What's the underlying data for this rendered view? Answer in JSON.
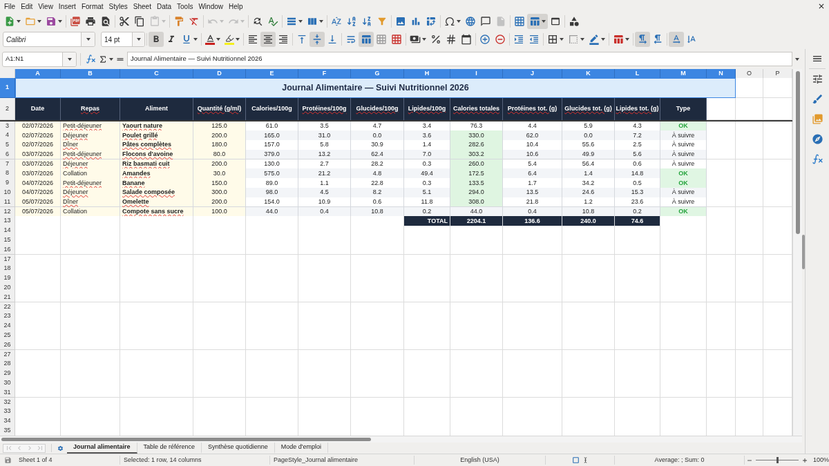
{
  "menu_bar": {
    "items": [
      "File",
      "Edit",
      "View",
      "Insert",
      "Format",
      "Styles",
      "Sheet",
      "Data",
      "Tools",
      "Window",
      "Help"
    ]
  },
  "standard_toolbar": {
    "paste_enabled": false,
    "undo_enabled": false,
    "redo_enabled": false,
    "headers_footers_enabled": false,
    "freeze_rows_columns": true
  },
  "formatting_toolbar": {
    "font_name": "Calibri",
    "font_size": "14 pt",
    "bold": true,
    "italic": false,
    "underline": false,
    "horizontal_align": {
      "left": false,
      "center": true,
      "right": false
    },
    "vertical_align": {
      "top": false,
      "middle": true,
      "bottom": false
    },
    "merge_and_center": true,
    "paragraph_direction": {
      "left_to_right": true,
      "right_to_left": false
    },
    "text_orientation": {
      "horizontal": true,
      "vertical": false
    }
  },
  "formula_bar": {
    "name_box": "A1:N1",
    "content": "Journal Alimentaire — Suivi Nutritionnel 2026"
  },
  "sheet": {
    "columns": [
      {
        "label": "A",
        "selected": true
      },
      {
        "label": "B",
        "selected": true
      },
      {
        "label": "C",
        "selected": true
      },
      {
        "label": "D",
        "selected": true
      },
      {
        "label": "E",
        "selected": true
      },
      {
        "label": "F",
        "selected": true
      },
      {
        "label": "G",
        "selected": true
      },
      {
        "label": "H",
        "selected": true
      },
      {
        "label": "I",
        "selected": true
      },
      {
        "label": "J",
        "selected": true
      },
      {
        "label": "K",
        "selected": true
      },
      {
        "label": "L",
        "selected": true
      },
      {
        "label": "M",
        "selected": true
      },
      {
        "label": "N",
        "selected": true
      },
      {
        "label": "O",
        "selected": false
      },
      {
        "label": "P",
        "selected": false
      }
    ],
    "rows": [
      {
        "label": "1",
        "selected": true
      },
      {
        "label": "2",
        "selected": false
      },
      {
        "label": "3",
        "selected": false
      },
      {
        "label": "4",
        "selected": false
      },
      {
        "label": "5",
        "selected": false
      },
      {
        "label": "6",
        "selected": false
      },
      {
        "label": "7",
        "selected": false
      },
      {
        "label": "8",
        "selected": false
      },
      {
        "label": "9",
        "selected": false
      },
      {
        "label": "10",
        "selected": false
      },
      {
        "label": "11",
        "selected": false
      },
      {
        "label": "12",
        "selected": false
      },
      {
        "label": "13",
        "selected": false
      },
      {
        "label": "14",
        "selected": false
      },
      {
        "label": "15",
        "selected": false
      },
      {
        "label": "16",
        "selected": false
      },
      {
        "label": "17",
        "selected": false
      },
      {
        "label": "18",
        "selected": false
      },
      {
        "label": "19",
        "selected": false
      },
      {
        "label": "20",
        "selected": false
      },
      {
        "label": "21",
        "selected": false
      },
      {
        "label": "22",
        "selected": false
      },
      {
        "label": "23",
        "selected": false
      },
      {
        "label": "24",
        "selected": false
      },
      {
        "label": "25",
        "selected": false
      },
      {
        "label": "26",
        "selected": false
      },
      {
        "label": "27",
        "selected": false
      },
      {
        "label": "28",
        "selected": false
      },
      {
        "label": "29",
        "selected": false
      },
      {
        "label": "30",
        "selected": false
      },
      {
        "label": "31",
        "selected": false
      },
      {
        "label": "32",
        "selected": false
      },
      {
        "label": "33",
        "selected": false
      },
      {
        "label": "34",
        "selected": false
      },
      {
        "label": "35",
        "selected": false
      }
    ],
    "title": {
      "text": "Journal Alimentaire — Suivi Nutritionnel 2026",
      "selected": true
    },
    "header": [
      {
        "text": "Date",
        "misspelled": false
      },
      {
        "text": "Repas",
        "misspelled": true
      },
      {
        "text": "Aliment",
        "misspelled": false
      },
      {
        "text": "Quantité (g/ml)",
        "misspelled": true
      },
      {
        "text": "Calories/100g",
        "misspelled": false
      },
      {
        "text": "Protéines/100g",
        "misspelled": true
      },
      {
        "text": "Glucides/100g",
        "misspelled": true
      },
      {
        "text": "Lipides/100g",
        "misspelled": true
      },
      {
        "text": "Calories totales",
        "misspelled": true
      },
      {
        "text": "Protéines tot. (g)",
        "misspelled": true
      },
      {
        "text": "Glucides tot. (g)",
        "misspelled": true
      },
      {
        "text": "Lipides tot. (g)",
        "misspelled": true
      },
      {
        "text": "Type",
        "misspelled": false
      }
    ],
    "entries": [
      {
        "date": "02/07/2026",
        "meal": "Petit-déjeuner",
        "meal_misspelled": true,
        "food": "Yaourt nature",
        "food_misspelled": true,
        "quantity": "125.0",
        "calories_per_100g": "61.0",
        "proteins_per_100g": "3.5",
        "carbs_per_100g": "4.7",
        "fat_per_100g": "3.4",
        "calories_total": "76.3",
        "calories_high": false,
        "proteins_total": "4.4",
        "carbs_total": "5.9",
        "fat_total": "4.3",
        "type": "OK",
        "type_ok": true
      },
      {
        "date": "02/07/2026",
        "meal": "Déjeuner",
        "meal_misspelled": true,
        "food": "Poulet grillé",
        "food_misspelled": true,
        "quantity": "200.0",
        "calories_per_100g": "165.0",
        "proteins_per_100g": "31.0",
        "carbs_per_100g": "0.0",
        "fat_per_100g": "3.6",
        "calories_total": "330.0",
        "calories_high": true,
        "proteins_total": "62.0",
        "carbs_total": "0.0",
        "fat_total": "7.2",
        "type": "À suivre",
        "type_ok": false
      },
      {
        "date": "02/07/2026",
        "meal": "Dîner",
        "meal_misspelled": true,
        "food": "Pâtes complètes",
        "food_misspelled": true,
        "quantity": "180.0",
        "calories_per_100g": "157.0",
        "proteins_per_100g": "5.8",
        "carbs_per_100g": "30.9",
        "fat_per_100g": "1.4",
        "calories_total": "282.6",
        "calories_high": true,
        "proteins_total": "10.4",
        "carbs_total": "55.6",
        "fat_total": "2.5",
        "type": "À suivre",
        "type_ok": false
      },
      {
        "date": "03/07/2026",
        "meal": "Petit-déjeuner",
        "meal_misspelled": true,
        "food": "Flocons d'avoine",
        "food_misspelled": true,
        "quantity": "80.0",
        "calories_per_100g": "379.0",
        "proteins_per_100g": "13.2",
        "carbs_per_100g": "62.4",
        "fat_per_100g": "7.0",
        "calories_total": "303.2",
        "calories_high": true,
        "proteins_total": "10.6",
        "carbs_total": "49.9",
        "fat_total": "5.6",
        "type": "À suivre",
        "type_ok": false
      },
      {
        "date": "03/07/2026",
        "meal": "Déjeuner",
        "meal_misspelled": true,
        "food": "Riz basmati cuit",
        "food_misspelled": true,
        "quantity": "200.0",
        "calories_per_100g": "130.0",
        "proteins_per_100g": "2.7",
        "carbs_per_100g": "28.2",
        "fat_per_100g": "0.3",
        "calories_total": "260.0",
        "calories_high": true,
        "proteins_total": "5.4",
        "carbs_total": "56.4",
        "fat_total": "0.6",
        "type": "À suivre",
        "type_ok": false
      },
      {
        "date": "03/07/2026",
        "meal": "Collation",
        "meal_misspelled": false,
        "food": "Amandes",
        "food_misspelled": true,
        "quantity": "30.0",
        "calories_per_100g": "575.0",
        "proteins_per_100g": "21.2",
        "carbs_per_100g": "4.8",
        "fat_per_100g": "49.4",
        "calories_total": "172.5",
        "calories_high": true,
        "proteins_total": "6.4",
        "carbs_total": "1.4",
        "fat_total": "14.8",
        "type": "OK",
        "type_ok": true
      },
      {
        "date": "04/07/2026",
        "meal": "Petit-déjeuner",
        "meal_misspelled": true,
        "food": "Banane",
        "food_misspelled": true,
        "quantity": "150.0",
        "calories_per_100g": "89.0",
        "proteins_per_100g": "1.1",
        "carbs_per_100g": "22.8",
        "fat_per_100g": "0.3",
        "calories_total": "133.5",
        "calories_high": true,
        "proteins_total": "1.7",
        "carbs_total": "34.2",
        "fat_total": "0.5",
        "type": "OK",
        "type_ok": true
      },
      {
        "date": "04/07/2026",
        "meal": "Déjeuner",
        "meal_misspelled": true,
        "food": "Salade composée",
        "food_misspelled": true,
        "quantity": "300.0",
        "calories_per_100g": "98.0",
        "proteins_per_100g": "4.5",
        "carbs_per_100g": "8.2",
        "fat_per_100g": "5.1",
        "calories_total": "294.0",
        "calories_high": true,
        "proteins_total": "13.5",
        "carbs_total": "24.6",
        "fat_total": "15.3",
        "type": "À suivre",
        "type_ok": false
      },
      {
        "date": "05/07/2026",
        "meal": "Dîner",
        "meal_misspelled": true,
        "food": "Omelette",
        "food_misspelled": true,
        "quantity": "200.0",
        "calories_per_100g": "154.0",
        "proteins_per_100g": "10.9",
        "carbs_per_100g": "0.6",
        "fat_per_100g": "11.8",
        "calories_total": "308.0",
        "calories_high": true,
        "proteins_total": "21.8",
        "carbs_total": "1.2",
        "fat_total": "23.6",
        "type": "À suivre",
        "type_ok": false
      },
      {
        "date": "05/07/2026",
        "meal": "Collation",
        "meal_misspelled": false,
        "food": "Compote sans sucre",
        "food_misspelled": true,
        "quantity": "100.0",
        "calories_per_100g": "44.0",
        "proteins_per_100g": "0.4",
        "carbs_per_100g": "10.8",
        "fat_per_100g": "0.2",
        "calories_total": "44.0",
        "calories_high": false,
        "proteins_total": "0.4",
        "carbs_total": "10.8",
        "fat_total": "0.2",
        "type": "OK",
        "type_ok": true
      }
    ],
    "totals": {
      "label": "TOTAL",
      "calories": "2204.1",
      "proteins": "136.6",
      "carbs": "240.0",
      "fat": "74.6"
    }
  },
  "sheet_tabs": {
    "tabs": [
      {
        "label": "Journal alimentaire",
        "selected": true
      },
      {
        "label": "Table de référence",
        "selected": false
      },
      {
        "label": "Synthèse quotidienne",
        "selected": false
      },
      {
        "label": "Mode d'emploi",
        "selected": false
      }
    ]
  },
  "status_bar": {
    "sheet": "Sheet 1 of 4",
    "selection": "Selected: 1 row, 14 columns",
    "page_style": "PageStyle_Journal alimentaire",
    "language": "English (USA)",
    "statistics": "Average: ; Sum: 0",
    "zoom_slider": {
      "level": 0.5
    },
    "zoom": "100%"
  }
}
